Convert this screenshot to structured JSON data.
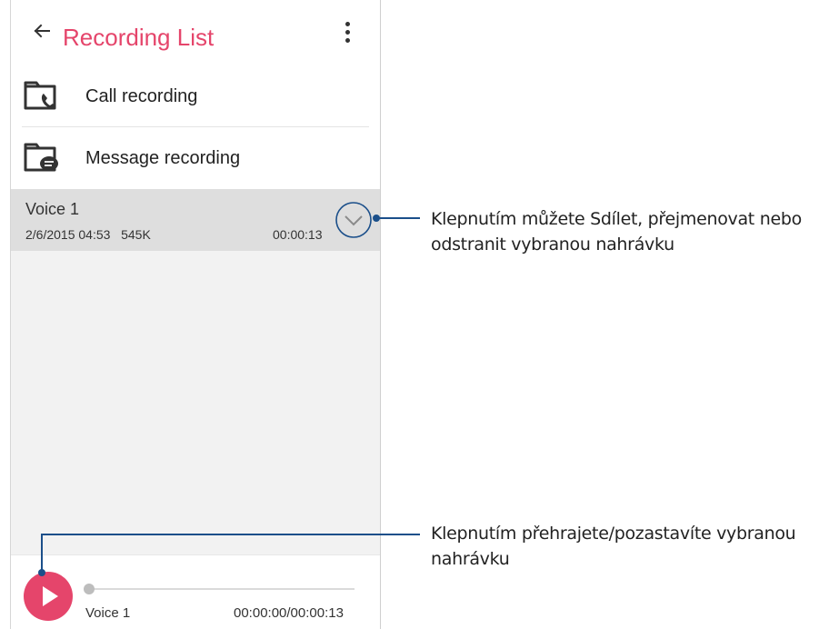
{
  "app_bar": {
    "title": "Recording List",
    "back_icon": "arrow-left-icon",
    "menu_icon": "more-vert-icon"
  },
  "folders": [
    {
      "label": "Call recording",
      "icon": "call-recording-folder-icon"
    },
    {
      "label": "Message recording",
      "icon": "message-recording-folder-icon"
    }
  ],
  "recording": {
    "title": "Voice 1",
    "date": "2/6/2015 04:53",
    "size": "545K",
    "duration": "00:00:13",
    "expand_icon": "chevron-down-icon"
  },
  "player": {
    "name": "Voice 1",
    "time": "00:00:00/00:00:13",
    "progress": 0,
    "play_icon": "play-icon"
  },
  "callouts": {
    "expand_line1": "Klepnutím můžete Sdílet, přejmenovat nebo",
    "expand_line2": "odstranit vybranou nahrávku",
    "play_line1": "Klepnutím přehrajete/pozastavíte vybranou",
    "play_line2": "nahrávku"
  },
  "colors": {
    "accent": "#e5456b",
    "callout": "#1b4f8a",
    "selected_row": "#dedede"
  }
}
